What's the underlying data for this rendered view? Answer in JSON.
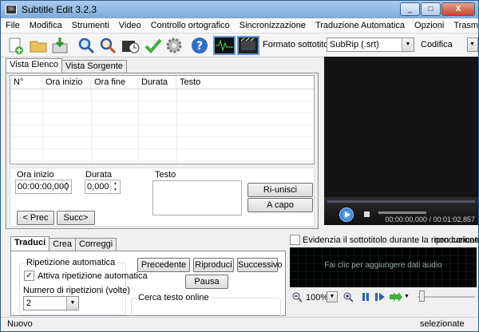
{
  "window": {
    "title": "Subtitle Edit 3.2.3",
    "minimize": "_",
    "maximize": "□",
    "close": "X"
  },
  "menu": [
    "File",
    "Modifica",
    "Strumenti",
    "Video",
    "Controllo ortografico",
    "Sincronizzazione",
    "Traduzione Automatica",
    "Opzioni",
    "Trasmissione"
  ],
  "toolbar": {
    "format_label": "Formato sottotitoli",
    "format_value": "SubRip (.srt)",
    "encoding_label": "Codifica"
  },
  "top_tabs": [
    "Vista Elenco",
    "Vista Sorgente"
  ],
  "grid": {
    "columns": [
      "N°",
      "Ora inizio",
      "Ora fine",
      "Durata",
      "Testo"
    ]
  },
  "editor": {
    "start_label": "Ora inizio",
    "start_value": "00:00:00,000",
    "duration_label": "Durata",
    "duration_value": "0,000",
    "text_label": "Testo",
    "prev_button": "< Prec",
    "next_button": "Succ>",
    "rejoin_button": "Ri-unisci",
    "newline_button": "A capo"
  },
  "video": {
    "timecode": "00:00:00,000 / 00:01:02,857"
  },
  "bottom_tabs": [
    "Traduci",
    "Crea",
    "Correggi"
  ],
  "translate": {
    "auto_repeat_group": "Ripetizione automatica",
    "auto_repeat_check": "Attiva ripetizione automatica",
    "repeat_count_label": "Numero di ripetizioni (volte)",
    "repeat_count_value": "2",
    "previous_button": "Precedente",
    "play_button": "Riproduci",
    "next_button": "Successivo",
    "pause_button": "Pausa",
    "search_online_group": "Cerca testo online"
  },
  "waveform": {
    "highlight_label": "Evidenzia il sottotitolo durante la riproduzione",
    "not_loaded": "non caricato",
    "placeholder": "Fai clic per aggiungere dati audio",
    "zoom": "100%"
  },
  "status": {
    "left": "Nuovo",
    "right": "selezionate"
  }
}
